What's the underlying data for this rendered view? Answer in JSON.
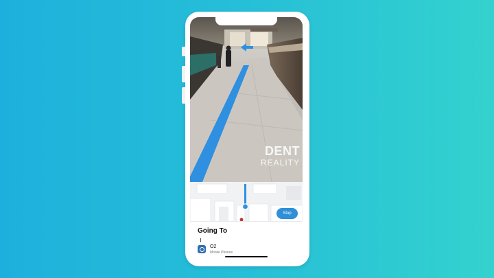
{
  "watermark": {
    "line1": "DENT",
    "line2": "REALITY"
  },
  "map": {
    "stop_label": "Stop"
  },
  "sheet": {
    "title": "Going To",
    "destination": {
      "name": "O2",
      "category": "Mobile Phones",
      "icon": "store-pin-icon"
    }
  },
  "colors": {
    "background_left": "#1eb0dc",
    "background_right": "#34d2ce",
    "route": "#2f8fe0",
    "button": "#2f8fd8"
  }
}
